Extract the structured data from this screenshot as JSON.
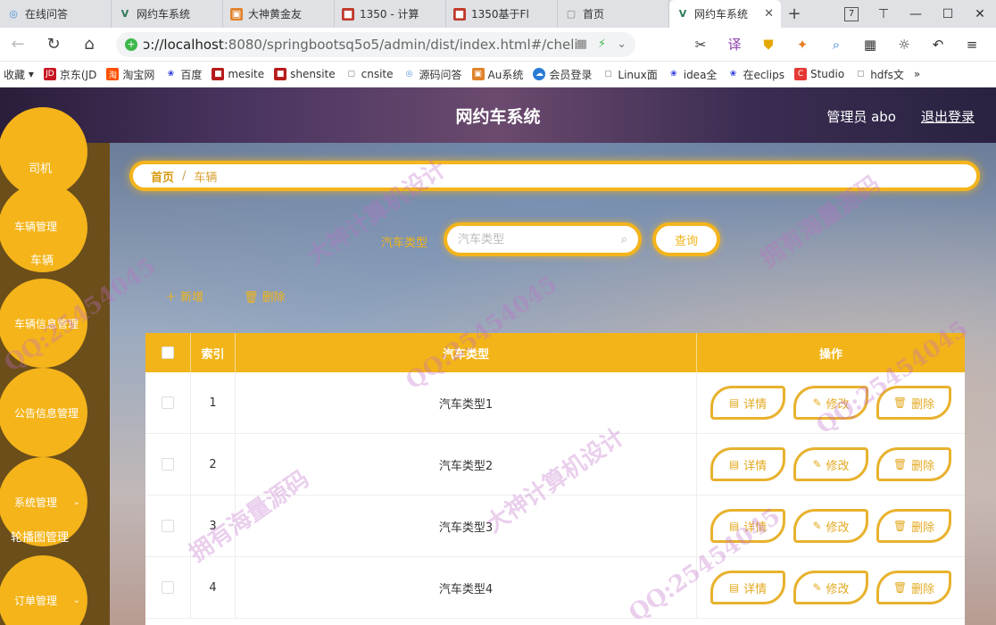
{
  "browser": {
    "tabs": [
      {
        "label": "在线问答",
        "icon": "globe-icon",
        "color": "#4a90d9"
      },
      {
        "label": "网约车系统",
        "icon": "vue-icon",
        "color": "#2d7a56"
      },
      {
        "label": "大神黄金友",
        "icon": "square-icon",
        "color": "#e0822a"
      },
      {
        "label": "1350 - 计算",
        "icon": "red-icon",
        "color": "#c0392b"
      },
      {
        "label": "1350基于Fl",
        "icon": "red-icon",
        "color": "#c0392b"
      },
      {
        "label": "首页",
        "icon": "page-icon",
        "color": "#999999"
      },
      {
        "label": "网约车系统",
        "icon": "vue-icon",
        "color": "#2d7a56",
        "active": true
      }
    ],
    "window_controls": {
      "count_badge": "7",
      "minimize": "—",
      "maximize": "☐",
      "close": "✕"
    },
    "url": {
      "host": "localhost",
      "rest": ":8080/springbootsq5o5/admin/dist/index.html#/cheliang",
      "prefix": "ɔ://"
    },
    "bookmarks": [
      {
        "label": "收藏",
        "color": ""
      },
      {
        "label": "京东(JD",
        "color": "#c81623"
      },
      {
        "label": "淘宝网",
        "color": "#ff5000"
      },
      {
        "label": "百度",
        "color": "#2932e1"
      },
      {
        "label": "mesite",
        "color": "#b71c1c"
      },
      {
        "label": "shensite",
        "color": "#b71c1c"
      },
      {
        "label": "cnsite",
        "color": "#9e9e9e"
      },
      {
        "label": "源码问答",
        "color": "#4a90d9"
      },
      {
        "label": "Au系统",
        "color": "#e0822a"
      },
      {
        "label": "会员登录",
        "color": "#2b7bd6"
      },
      {
        "label": "Linux面",
        "color": "#9e9e9e"
      },
      {
        "label": "idea全",
        "color": "#2932e1"
      },
      {
        "label": "在eclips",
        "color": "#2932e1"
      },
      {
        "label": "Studio",
        "color": "#e53935"
      },
      {
        "label": "hdfs文",
        "color": "#9e9e9e"
      },
      {
        "label": "»",
        "color": ""
      }
    ]
  },
  "app": {
    "title": "网约车系统",
    "admin": "管理员 abo",
    "logout": "退出登录",
    "sidebar": {
      "items": [
        {
          "label": "司机"
        },
        {
          "label": "车辆管理",
          "sub": "车辆"
        },
        {
          "label": "车辆信息管理"
        },
        {
          "label": "公告信息管理"
        },
        {
          "label": "系统管理",
          "sub": "轮播图管理",
          "chevron": "⌄"
        },
        {
          "label": "订单管理",
          "chevron": "⌄"
        }
      ]
    },
    "breadcrumb": {
      "home": "首页",
      "sep": "/",
      "current": "车辆"
    },
    "search": {
      "label": "汽车类型",
      "placeholder": "汽车类型",
      "button": "查询"
    },
    "actions": {
      "add": "新增",
      "delete": "删除"
    },
    "table": {
      "headers": {
        "index": "索引",
        "type": "汽车类型",
        "ops": "操作"
      },
      "rows": [
        {
          "index": "1",
          "type": "汽车类型1"
        },
        {
          "index": "2",
          "type": "汽车类型2"
        },
        {
          "index": "3",
          "type": "汽车类型3"
        },
        {
          "index": "4",
          "type": "汽车类型4"
        }
      ],
      "ops": {
        "detail": "详情",
        "edit": "修改",
        "delete": "删除"
      }
    },
    "watermarks": [
      "QQ:25454045",
      "大神计算机设计",
      "拥有海量源码"
    ]
  }
}
